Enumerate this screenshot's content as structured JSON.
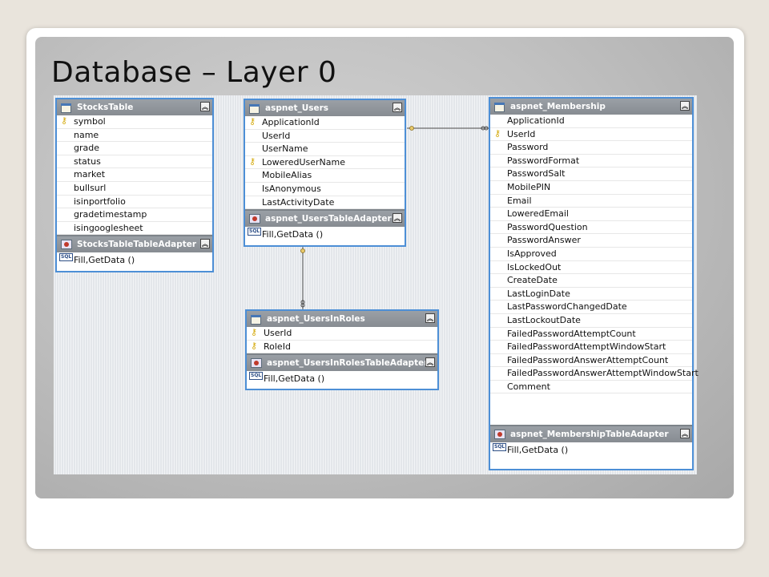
{
  "slide": {
    "title": "Database – Layer 0"
  },
  "tables": {
    "stocks": {
      "name": "StocksTable",
      "fields": [
        "symbol",
        "name",
        "grade",
        "status",
        "market",
        "bullsurl",
        "isinportfolio",
        "gradetimestamp",
        "isingooglesheet"
      ],
      "adapter": "StocksTableTableAdapter",
      "method": "Fill,GetData ()"
    },
    "users": {
      "name": "aspnet_Users",
      "fields": [
        "ApplicationId",
        "UserId",
        "UserName",
        "LoweredUserName",
        "MobileAlias",
        "IsAnonymous",
        "LastActivityDate"
      ],
      "adapter": "aspnet_UsersTableAdapter",
      "method": "Fill,GetData ()"
    },
    "usersinroles": {
      "name": "aspnet_UsersInRoles",
      "fields": [
        "UserId",
        "RoleId"
      ],
      "adapter": "aspnet_UsersInRolesTableAdapter",
      "method": "Fill,GetData ()"
    },
    "membership": {
      "name": "aspnet_Membership",
      "fields": [
        "ApplicationId",
        "UserId",
        "Password",
        "PasswordFormat",
        "PasswordSalt",
        "MobilePIN",
        "Email",
        "LoweredEmail",
        "PasswordQuestion",
        "PasswordAnswer",
        "IsApproved",
        "IsLockedOut",
        "CreateDate",
        "LastLoginDate",
        "LastPasswordChangedDate",
        "LastLockoutDate",
        "FailedPasswordAttemptCount",
        "FailedPasswordAttemptWindowStart",
        "FailedPasswordAnswerAttemptCount",
        "FailedPasswordAnswerAttemptWindowStart",
        "Comment"
      ],
      "adapter": "aspnet_MembershipTableAdapter",
      "method": "Fill,GetData ()"
    }
  },
  "icons": {
    "table": "table-icon",
    "key": "key-icon",
    "adapter": "table-adapter-icon",
    "sql": "sql-query-icon",
    "collapse": "collapse-chevron-icon"
  },
  "colors": {
    "border": "#4d8fd6",
    "header": "#8d9298",
    "key": "#d4a90a"
  }
}
